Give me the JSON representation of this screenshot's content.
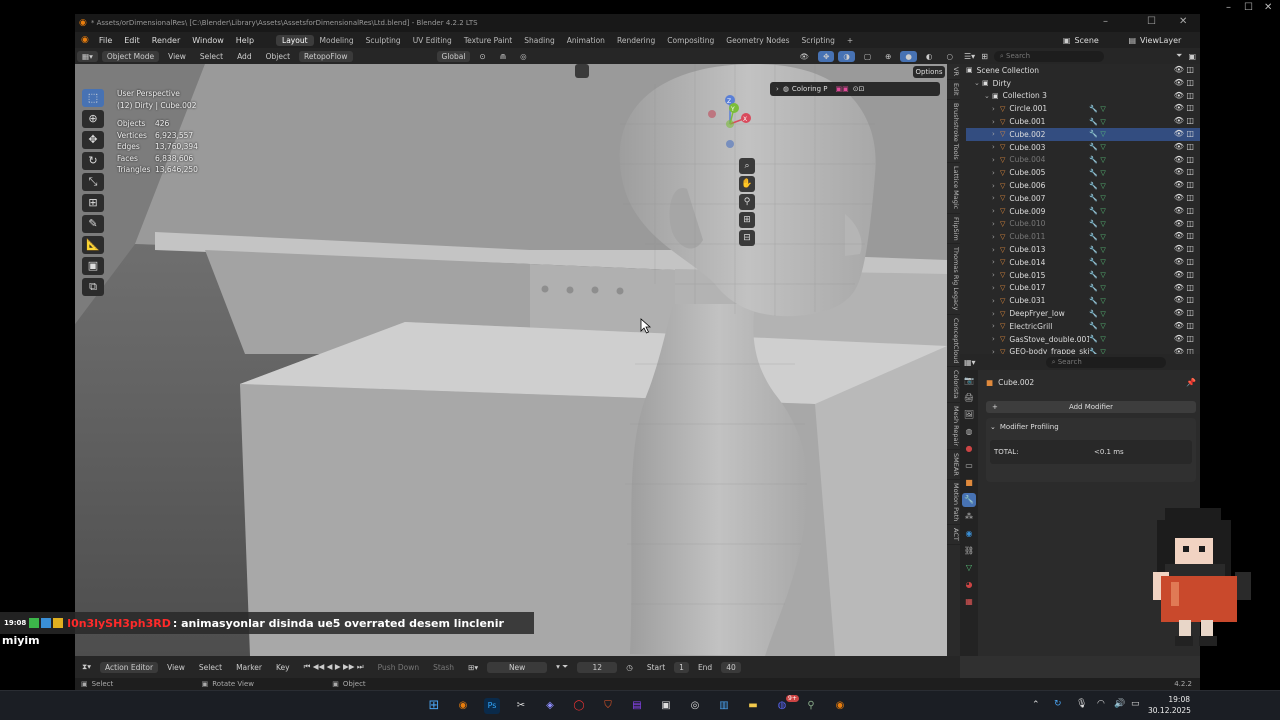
{
  "window": {
    "title": "* Assets/orDimensionalRes\\ [C:\\Blender\\Library\\Assets\\AssetsforDimensionalRes\\Ltd.blend] - Blender 4.2.2 LTS",
    "min": "–",
    "max": "☐",
    "close": "✕"
  },
  "desktop_controls": {
    "min": "–",
    "max": "☐",
    "close": "✕"
  },
  "menus": [
    "File",
    "Edit",
    "Render",
    "Window",
    "Help"
  ],
  "workspaces": [
    "Layout",
    "Modeling",
    "Sculpting",
    "UV Editing",
    "Texture Paint",
    "Shading",
    "Animation",
    "Rendering",
    "Compositing",
    "Geometry Nodes",
    "Scripting",
    "+"
  ],
  "active_workspace": "Layout",
  "scene": {
    "icon": "scene-icon",
    "name": "Scene",
    "view_layer": "ViewLayer"
  },
  "viewport_header": {
    "mode": "Object Mode",
    "menus": [
      "View",
      "Select",
      "Add",
      "Object"
    ],
    "retopo": "RetopoFlow",
    "orientation": "Global",
    "options": "Options"
  },
  "viewport_overlay": {
    "perspective": "User Perspective",
    "collection": "(12) Dirty | Cube.002",
    "stats": [
      {
        "label": "Objects",
        "value": "426"
      },
      {
        "label": "Vertices",
        "value": "6,923,557"
      },
      {
        "label": "Edges",
        "value": "13,760,394"
      },
      {
        "label": "Faces",
        "value": "6,838,606"
      },
      {
        "label": "Triangles",
        "value": "13,646,250"
      }
    ],
    "coloring_panel": "Coloring P",
    "gizmo_axes": [
      "Z",
      "Y",
      "X"
    ]
  },
  "sidebar_tabs": [
    "VR",
    "Edit",
    "Brushstroke Tools",
    "Lattice Magic",
    "FlipSim",
    "Thomas Rig Legacy",
    "ConceptCloud",
    "Colorista",
    "Mesh Repair",
    "SMEAR",
    "Motion Path",
    "ACT"
  ],
  "outliner": {
    "header": "Scene Collection",
    "search_placeholder": "Search",
    "rows": [
      {
        "name": "Dirty",
        "level": 1,
        "type": "collection",
        "selected": false,
        "dim": false
      },
      {
        "name": "Collection 3",
        "level": 2,
        "type": "collection",
        "selected": false,
        "dim": false
      },
      {
        "name": "Circle.001",
        "level": 3,
        "type": "object",
        "selected": false,
        "dim": false
      },
      {
        "name": "Cube.001",
        "level": 3,
        "type": "object",
        "selected": false,
        "dim": false
      },
      {
        "name": "Cube.002",
        "level": 3,
        "type": "object",
        "selected": true,
        "dim": false
      },
      {
        "name": "Cube.003",
        "level": 3,
        "type": "object",
        "selected": false,
        "dim": false
      },
      {
        "name": "Cube.004",
        "level": 3,
        "type": "object",
        "selected": false,
        "dim": true
      },
      {
        "name": "Cube.005",
        "level": 3,
        "type": "object",
        "selected": false,
        "dim": false
      },
      {
        "name": "Cube.006",
        "level": 3,
        "type": "object",
        "selected": false,
        "dim": false
      },
      {
        "name": "Cube.007",
        "level": 3,
        "type": "object",
        "selected": false,
        "dim": false
      },
      {
        "name": "Cube.009",
        "level": 3,
        "type": "object",
        "selected": false,
        "dim": false
      },
      {
        "name": "Cube.010",
        "level": 3,
        "type": "object",
        "selected": false,
        "dim": true
      },
      {
        "name": "Cube.011",
        "level": 3,
        "type": "object",
        "selected": false,
        "dim": true
      },
      {
        "name": "Cube.013",
        "level": 3,
        "type": "object",
        "selected": false,
        "dim": false
      },
      {
        "name": "Cube.014",
        "level": 3,
        "type": "object",
        "selected": false,
        "dim": false
      },
      {
        "name": "Cube.015",
        "level": 3,
        "type": "object",
        "selected": false,
        "dim": false
      },
      {
        "name": "Cube.017",
        "level": 3,
        "type": "object",
        "selected": false,
        "dim": false
      },
      {
        "name": "Cube.031",
        "level": 3,
        "type": "object",
        "selected": false,
        "dim": false
      },
      {
        "name": "DeepFryer_low",
        "level": 3,
        "type": "object",
        "selected": false,
        "dim": false
      },
      {
        "name": "ElectricGrill",
        "level": 3,
        "type": "object",
        "selected": false,
        "dim": false
      },
      {
        "name": "GasStove_double.001",
        "level": 3,
        "type": "object",
        "selected": false,
        "dim": false
      },
      {
        "name": "GEO-body_frappe_skillcard",
        "level": 3,
        "type": "object",
        "selected": false,
        "dim": false
      }
    ]
  },
  "properties": {
    "search_placeholder": "Search",
    "object_name": "Cube.002",
    "add_modifier": "Add Modifier",
    "section": "Modifier Profiling",
    "total_label": "TOTAL:",
    "total_value": "<0.1 ms"
  },
  "timeline": {
    "editor": "Action Editor",
    "menus": [
      "View",
      "Select",
      "Marker",
      "Key"
    ],
    "push_down": "Push Down",
    "stash": "Stash",
    "new": "New",
    "current_frame": "12",
    "start_label": "Start",
    "start_value": "1",
    "end_label": "End",
    "end_value": "40"
  },
  "statusbar": {
    "select": "Select",
    "rotate": "Rotate View",
    "object": "Object",
    "version": "4.2.2"
  },
  "chat": {
    "time": "19:08",
    "username": "l0n3lySH3ph3RD",
    "message": ": animasyonlar disinda ue5 overrated desem linclenir",
    "continuation": "miyim",
    "user_color": "#ff2a2a"
  },
  "taskbar": {
    "time": "19:08",
    "date": "30.12.2025",
    "badge": "9+"
  },
  "colors": {
    "accent": "#4772b3",
    "selection": "#334d80",
    "object_orange": "#e08a3c",
    "mesh_green": "#59c27a"
  }
}
